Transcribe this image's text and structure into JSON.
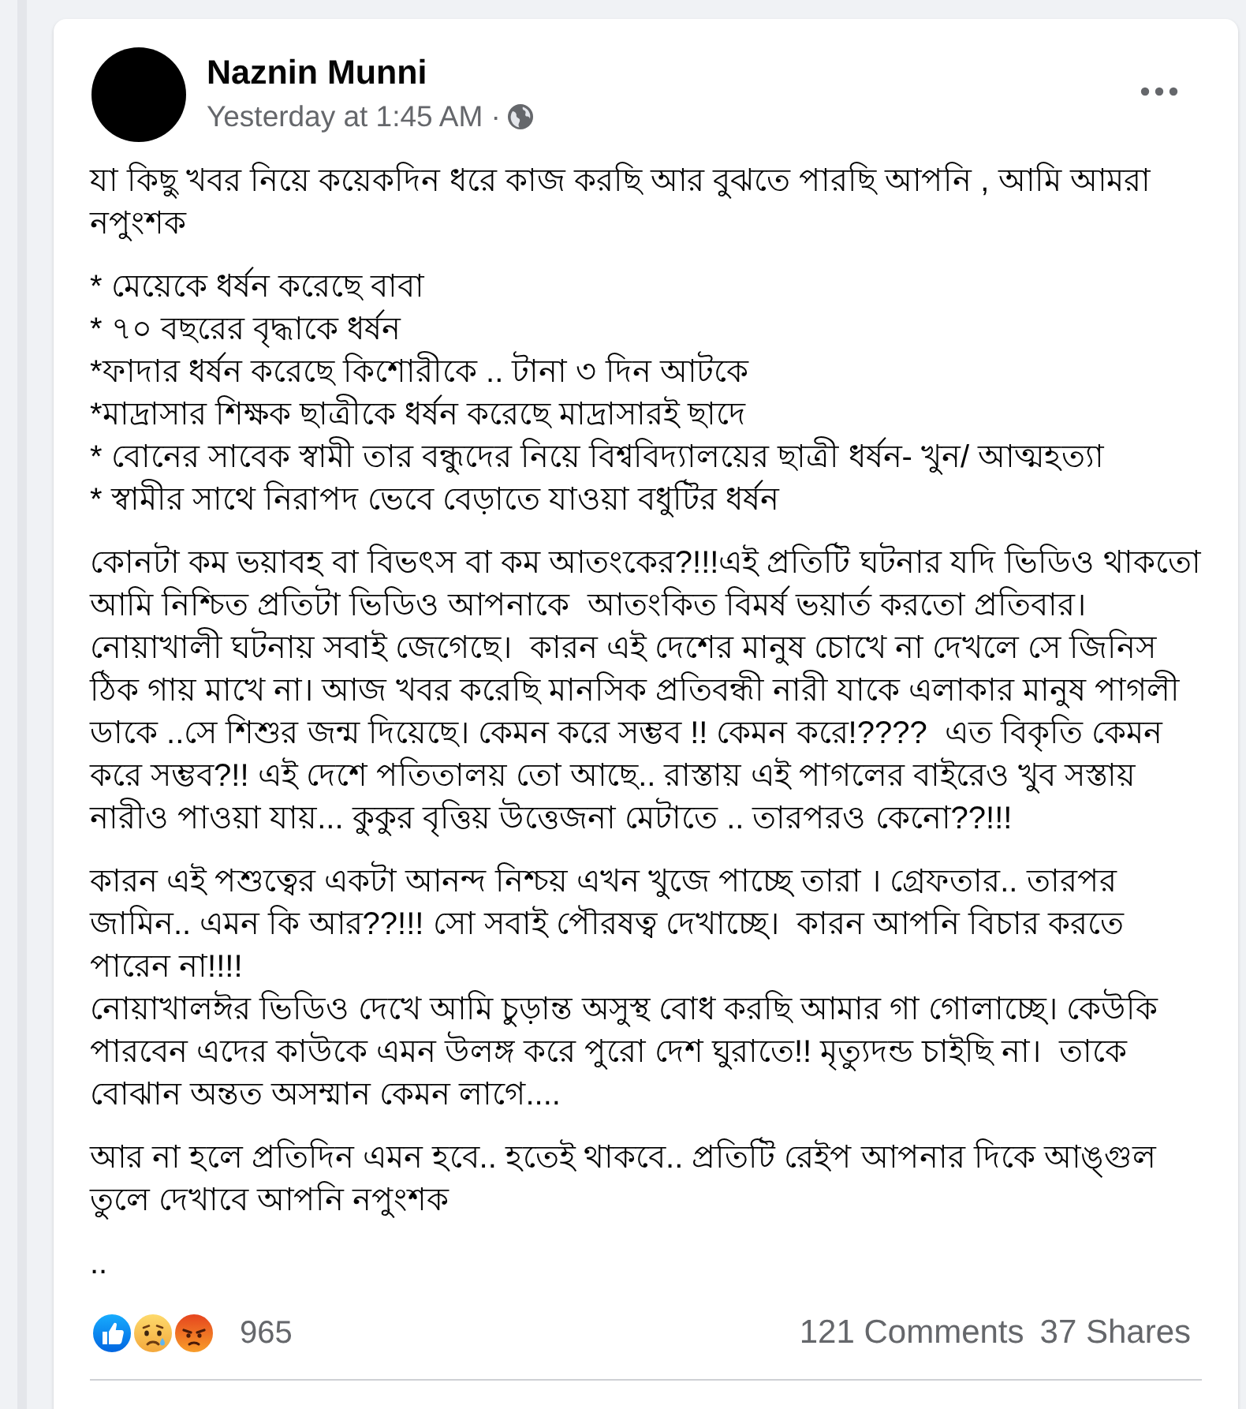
{
  "post": {
    "author": {
      "name": "Naznin Munni"
    },
    "timestamp": "Yesterday at 1:45 AM",
    "separator": "·",
    "blocks": [
      {
        "kind": "paragraph",
        "text": "যা কিছু খবর নিয়ে কয়েকদিন ধরে কাজ করছি আর বুঝতে পারছি আপনি , আমি আমরা  নপুংশক"
      },
      {
        "kind": "list",
        "items": [
          "* মেয়েকে ধর্ষন করেছে বাবা",
          "* ৭০ বছরের বৃদ্ধাকে ধর্ষন",
          "*ফাদার ধর্ষন করেছে কিশোরীকে .. টানা ৩ দিন আটকে",
          "*মাদ্রাসার শিক্ষক ছাত্রীকে ধর্ষন করেছে মাদ্রাসারই ছাদে",
          "* বোনের সাবেক স্বামী তার বন্ধুদের নিয়ে বিশ্ববিদ্যালয়ের ছাত্রী ধর্ষন- খুন/ আত্মহত্যা",
          "* স্বামীর সাথে নিরাপদ ভেবে বেড়াতে যাওয়া বধুটির ধর্ষন"
        ]
      },
      {
        "kind": "paragraph",
        "text": "কোনটা কম ভয়াবহ বা বিভৎস বা কম আতংকের?!!!এই প্রতিটি ঘটনার যদি ভিডিও থাকতো আমি নিশ্চিত প্রতিটা ভিডিও আপনাকে  আতংকিত বিমর্ষ ভয়ার্ত করতো প্রতিবার। নোয়াখালী ঘটনায় সবাই জেগেছে।  কারন এই দেশের মানুষ চোখে না দেখলে সে জিনিস ঠিক গায় মাখে না। আজ খবর করেছি মানসিক প্রতিবন্ধী নারী যাকে এলাকার মানুষ পাগলী ডাকে ..সে শিশুর জন্ম দিয়েছে। কেমন করে সম্ভব !! কেমন করে!????  এত বিকৃতি কেমন করে সম্ভব?!! এই দেশে পতিতালয় তো আছে.. রাস্তায় এই পাগলের বাইরেও খুব সস্তায় নারীও পাওয়া যায়... কুকুর বৃত্তিয় উত্তেজনা মেটাতে .. তারপরও কেনো??!!!"
      },
      {
        "kind": "paragraph",
        "text": "কারন এই পশুত্বের একটা আনন্দ নিশ্চয় এখন খুজে পাচ্ছে তারা । গ্রেফতার.. তারপর জামিন.. এমন কি আর??!!! সো সবাই পৌরষত্ব দেখাচ্ছে।  কারন আপনি বিচার করতে পারেন না!!!!\nনোয়াখালঈর ভিডিও দেখে আমি চুড়ান্ত অসুস্থ বোধ করছি আমার গা গোলাচ্ছে। কেউকি পারবেন এদের কাউকে এমন উলঙ্গ করে পুরো দেশ ঘুরাতে!! মৃত্যুদন্ড চাইছি না।  তাকে বোঝান অন্তত অসম্মান কেমন লাগে...."
      },
      {
        "kind": "paragraph",
        "text": "আর না হলে প্রতিদিন এমন হবে.. হতেই থাকবে.. প্রতিটি রেইপ আপনার দিকে আঙ্গুল তুলে দেখাবে আপনি নপুংশক"
      },
      {
        "kind": "paragraph",
        "text": ".."
      }
    ],
    "reaction_count": "965",
    "comments": "121 Comments",
    "shares": "37 Shares"
  }
}
